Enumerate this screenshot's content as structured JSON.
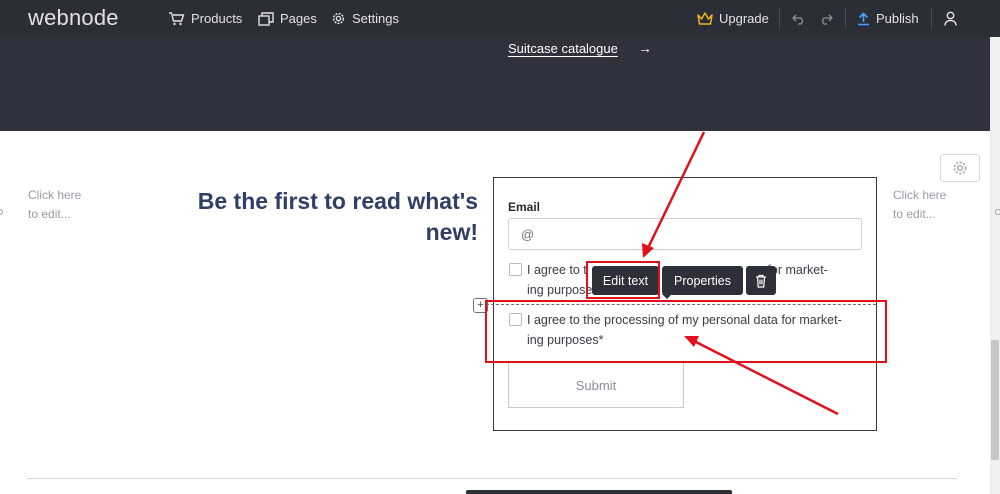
{
  "app": {
    "logo": "webnode"
  },
  "toolbar": {
    "products": "Products",
    "pages": "Pages",
    "settings": "Settings",
    "upgrade": "Upgrade",
    "publish": "Publish",
    "icons": [
      "cart-icon",
      "pages-icon",
      "gear-icon",
      "crown-icon",
      "undo-icon",
      "redo-icon",
      "upload-icon",
      "user-icon"
    ]
  },
  "hero": {
    "link": "Suitcase catalogue",
    "arrow": "→"
  },
  "section": {
    "click_here_left": [
      "Click here",
      "to edit..."
    ],
    "click_here_right": [
      "Click here",
      "to edit..."
    ],
    "heading_line1": "Be the first to read what's",
    "heading_line2": "new!"
  },
  "form": {
    "email_label": "Email",
    "email_placeholder": "@",
    "consent_1_line1": "I agree to t",
    "consent_1_line1_end": "a for market-",
    "consent_1_line2": "ing purpose",
    "consent_2_line1": "I agree to the processing of my personal data for market-",
    "consent_2_line2": "ing purposes*",
    "submit": "Submit"
  },
  "element_toolbar": {
    "edit_text": "Edit text",
    "properties": "Properties",
    "delete_icon": "trash-icon"
  },
  "colors": {
    "accent": "#e0111a",
    "dark": "#2b2d37",
    "heading": "#2f3f66",
    "upgrade": "#f0b429",
    "publish": "#4aa3ff"
  }
}
